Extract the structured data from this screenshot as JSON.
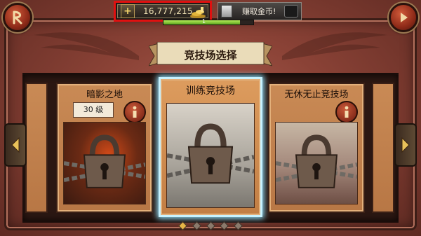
{
  "top_bar": {
    "coins": "16,777,215",
    "plus_symbol": "+",
    "earn_label": "赚取金币!",
    "xp_label": "1",
    "xp_progress": 0.85
  },
  "title": "竞技场选择",
  "cards": [
    {
      "name": "暗影之地",
      "level": "30 级",
      "scene": "fire",
      "locked": true,
      "selected": false
    },
    {
      "name": "训练竞技场",
      "scene": "snow",
      "locked": true,
      "selected": true
    },
    {
      "name": "无休无止竞技场",
      "scene": "ruins",
      "locked": true,
      "selected": false
    }
  ],
  "pagination": {
    "count": 5,
    "active": 0
  },
  "icons": {
    "back": "back-icon",
    "next": "next-icon",
    "info": "info-icon",
    "lock": "padlock-icon",
    "coin": "coin-pile-icon"
  },
  "colors": {
    "highlight": "#e01010",
    "selected_glow": "#8fe3ff",
    "xp_fill": "#5aa11c",
    "active_dot": "#e6b546"
  }
}
